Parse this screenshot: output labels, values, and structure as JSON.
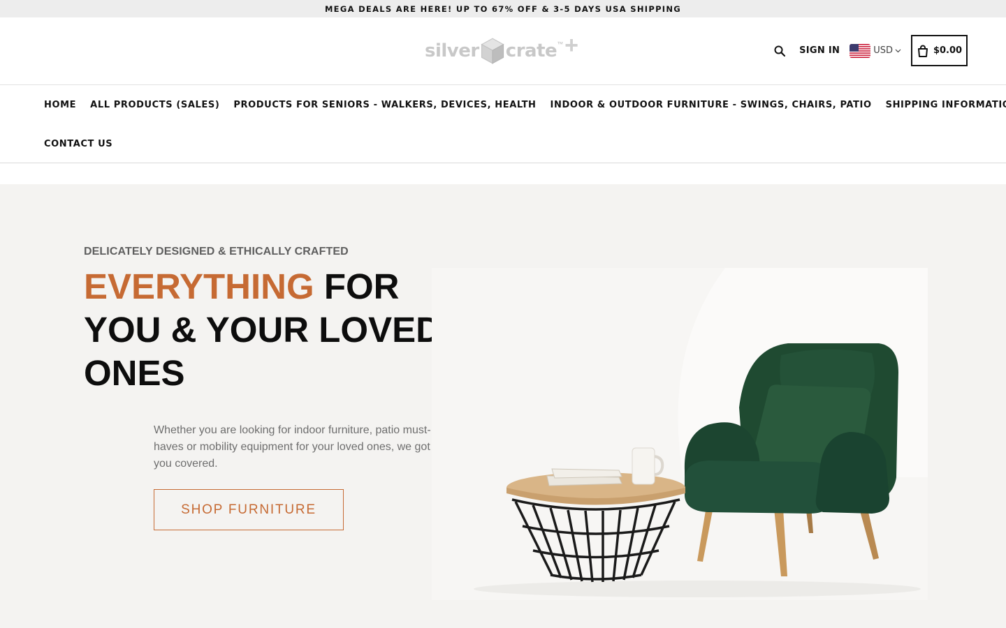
{
  "announcement": {
    "text": "MEGA DEALS ARE HERE! UP TO 67% OFF & 3-5 DAYS USA SHIPPING"
  },
  "header": {
    "logo": {
      "word_left": "silver",
      "word_right": "crate",
      "trademark": "™",
      "plus": "+"
    },
    "sign_in": "SIGN IN",
    "currency": {
      "code": "USD",
      "flag": "us-flag-icon"
    },
    "cart": {
      "total": "$0.00",
      "icon": "cart-bag-icon"
    },
    "search_icon": "search-icon"
  },
  "nav": {
    "items": [
      {
        "label": "HOME"
      },
      {
        "label": "ALL PRODUCTS (SALES)"
      },
      {
        "label": "PRODUCTS FOR SENIORS - WALKERS, DEVICES, HEALTH"
      },
      {
        "label": "INDOOR & OUTDOOR FURNITURE - SWINGS, CHAIRS, PATIO"
      },
      {
        "label": "SHIPPING INFORMATION"
      },
      {
        "label": "CONTACT US"
      }
    ]
  },
  "hero": {
    "eyebrow": "DELICATELY DESIGNED & ETHICALLY CRAFTED",
    "headline_accent": "EVERYTHING",
    "headline_rest": " FOR YOU & YOUR LOVED ONES",
    "subtext": "Whether you are looking for indoor furniture, patio must-haves or mobility equipment for your loved ones, we got you covered.",
    "cta": "SHOP FURNITURE"
  },
  "colors": {
    "accent": "#c66a33",
    "hero_bg": "#f4f3f1",
    "armchair_green": "#1f4a31",
    "table_top": "#d9b587"
  }
}
